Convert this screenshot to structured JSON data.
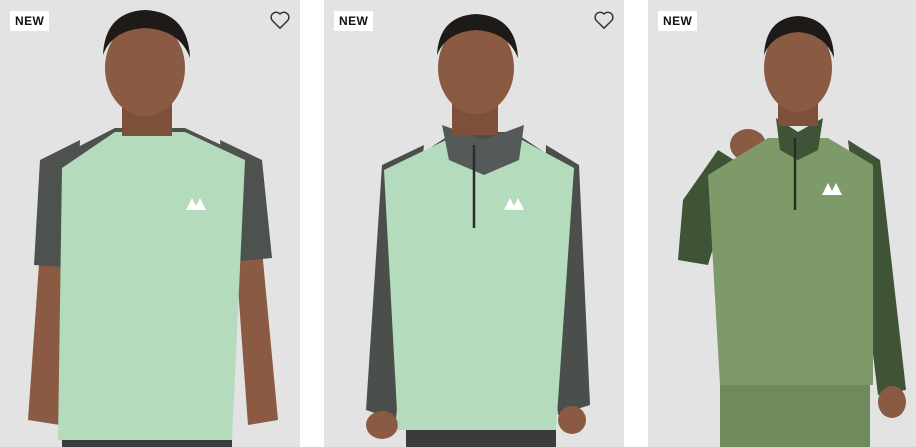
{
  "products": [
    {
      "badge": "NEW",
      "wishlist_icon": "heart-outline-icon",
      "garment": "short-sleeve-tee",
      "colors": {
        "body": "#b4dcbc",
        "sleeve": "#4e524f",
        "skin": "#8a5a42"
      }
    },
    {
      "badge": "NEW",
      "wishlist_icon": "heart-outline-icon",
      "garment": "long-sleeve-quarter-zip",
      "colors": {
        "body": "#b4dcbc",
        "sleeve": "#4b4f4c",
        "skin": "#8a5a42"
      }
    },
    {
      "badge": "NEW",
      "wishlist_icon": null,
      "garment": "long-sleeve-quarter-zip",
      "colors": {
        "body": "#7e9a68",
        "sleeve": "#3f5336",
        "skin": "#8a5a42"
      }
    }
  ]
}
